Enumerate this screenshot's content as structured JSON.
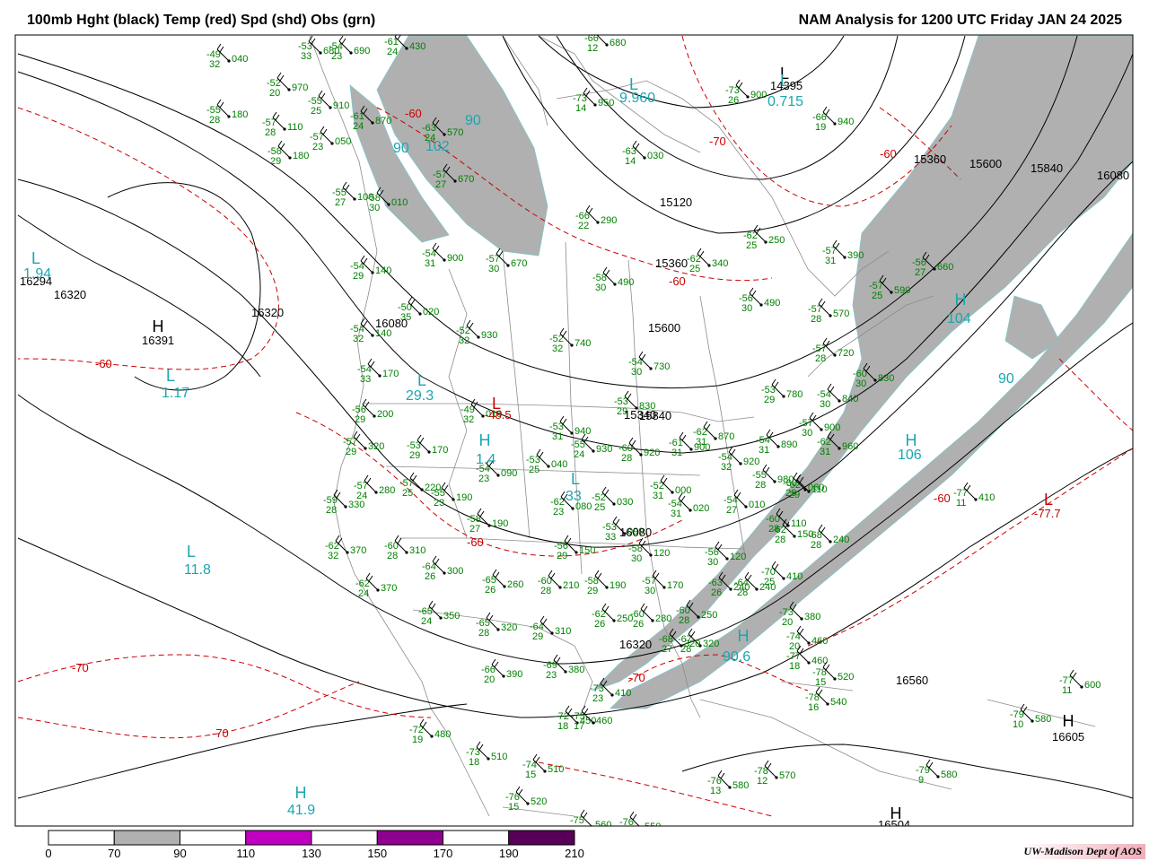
{
  "header": {
    "title_left": "100mb Hght (black) Temp (red) Spd (shd) Obs (grn)",
    "title_right": "NAM Analysis for 1200 UTC Friday  JAN 24 2025"
  },
  "credit": "UW-Madison  Dept of AOS",
  "colors": {
    "height": "#000000",
    "temp": "#cc0000",
    "obs": "#008000",
    "speed_label": "#1ba6b0",
    "shade_70_90": "#b0b0b0",
    "shade_110_130": "#c000c0",
    "shade_150_170": "#900090",
    "shade_190_210": "#580058",
    "borders": "#8c8c8c"
  },
  "colorbar": {
    "ticks": [
      "0",
      "70",
      "90",
      "110",
      "130",
      "150",
      "170",
      "190",
      "210"
    ],
    "segment_colors": [
      "#ffffff",
      "#b0b0b0",
      "#ffffff",
      "#c000c0",
      "#ffffff",
      "#900090",
      "#ffffff",
      "#580058"
    ]
  },
  "height_labels": [
    "16320",
    "16320",
    "16080",
    "16080",
    "16294",
    "15360",
    "15600",
    "15840",
    "16080",
    "15120",
    "15360",
    "15600",
    "15840",
    "15340",
    "16560",
    "16320",
    "16605",
    "16504",
    "14395",
    "16391"
  ],
  "temp_labels": [
    "-60",
    "-60",
    "-70",
    "-60",
    "-60",
    "-70",
    "-60",
    "-70",
    "-70",
    "-60",
    "-77.7",
    "-48.5"
  ],
  "speed_labels": [
    "90",
    "90",
    "102",
    "104",
    "106",
    "90",
    "29.3",
    "1.17",
    "11.8",
    "41.9",
    "90.6",
    "9.960",
    "0.715",
    "1.4",
    "33",
    "1.94"
  ],
  "extrema": [
    {
      "symbol": "L",
      "kind": "speed",
      "value": "9.960"
    },
    {
      "symbol": "L",
      "kind": "height",
      "value": "14395"
    },
    {
      "symbol": "L",
      "kind": "speed",
      "value": "0.715"
    },
    {
      "symbol": "L",
      "kind": "speed",
      "value": "1.94"
    },
    {
      "symbol": "H",
      "kind": "height",
      "value": "16391"
    },
    {
      "symbol": "L",
      "kind": "speed",
      "value": "1.17"
    },
    {
      "symbol": "L",
      "kind": "speed",
      "value": "29.3"
    },
    {
      "symbol": "H",
      "kind": "speed",
      "value": "1.4"
    },
    {
      "symbol": "L",
      "kind": "speed",
      "value": "33"
    },
    {
      "symbol": "L",
      "kind": "speed",
      "value": "11.8"
    },
    {
      "symbol": "H",
      "kind": "speed",
      "value": "41.9"
    },
    {
      "symbol": "H",
      "kind": "speed",
      "value": "104"
    },
    {
      "symbol": "H",
      "kind": "speed",
      "value": "106"
    },
    {
      "symbol": "H",
      "kind": "speed",
      "value": "90.6"
    },
    {
      "symbol": "L",
      "kind": "temp",
      "value": "-77.7"
    },
    {
      "symbol": "H",
      "kind": "height",
      "value": "16605"
    },
    {
      "symbol": "H",
      "kind": "height",
      "value": "16504"
    },
    {
      "symbol": "L",
      "kind": "temp",
      "value": "-48.5"
    }
  ],
  "observations": [
    {
      "t": "-49",
      "d": "32",
      "h": "040"
    },
    {
      "t": "-52",
      "d": "20",
      "h": "970"
    },
    {
      "t": "-55",
      "d": "28",
      "h": "180"
    },
    {
      "t": "-57",
      "d": "28",
      "h": "110"
    },
    {
      "t": "-58",
      "d": "29",
      "h": "180"
    },
    {
      "t": "-57",
      "d": "23",
      "h": "050"
    },
    {
      "t": "-55",
      "d": "25",
      "h": "910"
    },
    {
      "t": "-61",
      "d": "24",
      "h": "870"
    },
    {
      "t": "-55",
      "d": "27",
      "h": "100"
    },
    {
      "t": "-58",
      "d": "30",
      "h": "010"
    },
    {
      "t": "-53",
      "d": "33",
      "h": "680"
    },
    {
      "t": "-54",
      "d": "23",
      "h": "690"
    },
    {
      "t": "-61",
      "d": "24",
      "h": "430"
    },
    {
      "t": "-63",
      "d": "24",
      "h": "570"
    },
    {
      "t": "-57",
      "d": "27",
      "h": "670"
    },
    {
      "t": "-54",
      "d": "31",
      "h": "900"
    },
    {
      "t": "-57",
      "d": "30",
      "h": "670"
    },
    {
      "t": "-54",
      "d": "29",
      "h": "140"
    },
    {
      "t": "-50",
      "d": "35",
      "h": "020"
    },
    {
      "t": "-52",
      "d": "32",
      "h": "930"
    },
    {
      "t": "-54",
      "d": "32",
      "h": "140"
    },
    {
      "t": "-54",
      "d": "33",
      "h": "170"
    },
    {
      "t": "-56",
      "d": "29",
      "h": "200"
    },
    {
      "t": "-57",
      "d": "29",
      "h": "320"
    },
    {
      "t": "-53",
      "d": "29",
      "h": "170"
    },
    {
      "t": "-49",
      "d": "32",
      "h": "010"
    },
    {
      "t": "-54",
      "d": "23",
      "h": "090"
    },
    {
      "t": "-53",
      "d": "25",
      "h": "040"
    },
    {
      "t": "-57",
      "d": "24",
      "h": "280"
    },
    {
      "t": "-57",
      "d": "25",
      "h": "220"
    },
    {
      "t": "-59",
      "d": "28",
      "h": "330"
    },
    {
      "t": "-55",
      "d": "23",
      "h": "190"
    },
    {
      "t": "-58",
      "d": "27",
      "h": "190"
    },
    {
      "t": "-62",
      "d": "32",
      "h": "370"
    },
    {
      "t": "-60",
      "d": "28",
      "h": "310"
    },
    {
      "t": "-64",
      "d": "26",
      "h": "300"
    },
    {
      "t": "-62",
      "d": "24",
      "h": "370"
    },
    {
      "t": "-65",
      "d": "24",
      "h": "350"
    },
    {
      "t": "-65",
      "d": "26",
      "h": "260"
    },
    {
      "t": "-65",
      "d": "28",
      "h": "320"
    },
    {
      "t": "-64",
      "d": "29",
      "h": "310"
    },
    {
      "t": "-66",
      "d": "20",
      "h": "390"
    },
    {
      "t": "-69",
      "d": "23",
      "h": "380"
    },
    {
      "t": "-72",
      "d": "19",
      "h": "480"
    },
    {
      "t": "-73",
      "d": "18",
      "h": "510"
    },
    {
      "t": "-74",
      "d": "15",
      "h": "510"
    },
    {
      "t": "-76",
      "d": "15",
      "h": "520"
    },
    {
      "t": "-75",
      "d": "17",
      "h": "560"
    },
    {
      "t": "-76",
      "d": "18",
      "h": "550"
    },
    {
      "t": "-72",
      "d": "18",
      "h": "450"
    },
    {
      "t": "-75",
      "d": "17",
      "h": "460"
    },
    {
      "t": "-73",
      "d": "23",
      "h": "410"
    },
    {
      "t": "-76",
      "d": "13",
      "h": "580"
    },
    {
      "t": "-78",
      "d": "12",
      "h": "570"
    },
    {
      "t": "-52",
      "d": "32",
      "h": "740"
    },
    {
      "t": "-53",
      "d": "31",
      "h": "940"
    },
    {
      "t": "-55",
      "d": "24",
      "h": "930"
    },
    {
      "t": "-60",
      "d": "28",
      "h": "920"
    },
    {
      "t": "-61",
      "d": "31",
      "h": "900"
    },
    {
      "t": "-62",
      "d": "31",
      "h": "870"
    },
    {
      "t": "-54",
      "d": "32",
      "h": "920"
    },
    {
      "t": "-54",
      "d": "31",
      "h": "890"
    },
    {
      "t": "-53",
      "d": "29",
      "h": "830"
    },
    {
      "t": "-54",
      "d": "30",
      "h": "730"
    },
    {
      "t": "-52",
      "d": "25",
      "h": "030"
    },
    {
      "t": "-62",
      "d": "23",
      "h": "080"
    },
    {
      "t": "-52",
      "d": "31",
      "h": "000"
    },
    {
      "t": "-54",
      "d": "31",
      "h": "020"
    },
    {
      "t": "-54",
      "d": "27",
      "h": "010"
    },
    {
      "t": "-55",
      "d": "28",
      "h": "980"
    },
    {
      "t": "-56",
      "d": "29",
      "h": "150"
    },
    {
      "t": "-53",
      "d": "33",
      "h": "090"
    },
    {
      "t": "-58",
      "d": "30",
      "h": "120"
    },
    {
      "t": "-56",
      "d": "30",
      "h": "120"
    },
    {
      "t": "-60",
      "d": "28",
      "h": "210"
    },
    {
      "t": "-58",
      "d": "29",
      "h": "190"
    },
    {
      "t": "-57",
      "d": "30",
      "h": "170"
    },
    {
      "t": "-62",
      "d": "26",
      "h": "250"
    },
    {
      "t": "-60",
      "d": "26",
      "h": "280"
    },
    {
      "t": "-60",
      "d": "28",
      "h": "250"
    },
    {
      "t": "-63",
      "d": "26",
      "h": "240"
    },
    {
      "t": "-64",
      "d": "28",
      "h": "240"
    },
    {
      "t": "-67",
      "d": "28",
      "h": "320"
    },
    {
      "t": "-68",
      "d": "27",
      "h": "320"
    },
    {
      "t": "-70",
      "d": "25",
      "h": "410"
    },
    {
      "t": "-73",
      "d": "20",
      "h": "380"
    },
    {
      "t": "-74",
      "d": "20",
      "h": "460"
    },
    {
      "t": "-77",
      "d": "18",
      "h": "460"
    },
    {
      "t": "-78",
      "d": "15",
      "h": "520"
    },
    {
      "t": "-78",
      "d": "16",
      "h": "540"
    },
    {
      "t": "-60",
      "d": "28",
      "h": "110"
    },
    {
      "t": "-62",
      "d": "28",
      "h": "150"
    },
    {
      "t": "-68",
      "d": "28",
      "h": "240"
    },
    {
      "t": "-62",
      "d": "29",
      "h": "110"
    },
    {
      "t": "-60",
      "d": "28",
      "h": "060"
    },
    {
      "t": "-62",
      "d": "31",
      "h": "960"
    },
    {
      "t": "-57",
      "d": "30",
      "h": "900"
    },
    {
      "t": "-54",
      "d": "30",
      "h": "840"
    },
    {
      "t": "-53",
      "d": "29",
      "h": "780"
    },
    {
      "t": "-60",
      "d": "30",
      "h": "830"
    },
    {
      "t": "-57",
      "d": "28",
      "h": "720"
    },
    {
      "t": "-57",
      "d": "28",
      "h": "570"
    },
    {
      "t": "-56",
      "d": "30",
      "h": "490"
    },
    {
      "t": "-57",
      "d": "25",
      "h": "590"
    },
    {
      "t": "-56",
      "d": "27",
      "h": "660"
    },
    {
      "t": "-57",
      "d": "31",
      "h": "390"
    },
    {
      "t": "-62",
      "d": "25",
      "h": "250"
    },
    {
      "t": "-62",
      "d": "25",
      "h": "340"
    },
    {
      "t": "-58",
      "d": "30",
      "h": "490"
    },
    {
      "t": "-66",
      "d": "22",
      "h": "290"
    },
    {
      "t": "-63",
      "d": "14",
      "h": "030"
    },
    {
      "t": "-73",
      "d": "14",
      "h": "950"
    },
    {
      "t": "-73",
      "d": "26",
      "h": "900"
    },
    {
      "t": "-66",
      "d": "19",
      "h": "940"
    },
    {
      "t": "-66",
      "d": "12",
      "h": "680"
    },
    {
      "t": "-77",
      "d": "11",
      "h": "410"
    },
    {
      "t": "-77",
      "d": "11",
      "h": "600"
    },
    {
      "t": "-79",
      "d": "10",
      "h": "580"
    },
    {
      "t": "-79",
      "d": "9",
      "h": "580"
    }
  ]
}
